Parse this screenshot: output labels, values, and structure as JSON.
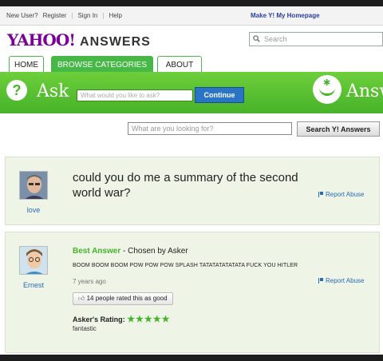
{
  "topbar": {
    "links": [
      "New User?",
      "Register",
      "Sign In",
      "Help"
    ],
    "homepage": "Make Y! My Homepage"
  },
  "logo": {
    "yahoo": "YAHOO!",
    "answers": "ANSWERS"
  },
  "header_search": {
    "placeholder": "Search"
  },
  "tabs": [
    {
      "label": "HOME",
      "active": false
    },
    {
      "label": "BROWSE CATEGORIES",
      "active": true
    },
    {
      "label": "ABOUT",
      "active": false
    }
  ],
  "ask_bar": {
    "ask_label": "Ask",
    "ask_placeholder": "What would you like to ask?",
    "continue_label": "Continue",
    "answer_label": "Answ"
  },
  "main_search": {
    "placeholder": "What are you looking for?",
    "button_label": "Search Y! Answers"
  },
  "question": {
    "user": "love",
    "text": "could you do me a summary of the second world war?",
    "report": "Report Abuse"
  },
  "best_answer": {
    "label": "Best Answer",
    "chosen_by": " - Chosen by Asker",
    "text": "BOOM BOOM BOOM POW POW POW SPLASH TATATATATATATA  FUCK YOU HITLER",
    "ago": "7 years ago",
    "user": "Ernest",
    "report": "Report Abuse",
    "rated": "14 people rated this as good",
    "rating_label": "Asker's Rating:",
    "stars": "★★★★★",
    "comment": "fantastic"
  },
  "colors": {
    "green": "#47b22a",
    "purple": "#7b0099",
    "link": "#2a6cb2",
    "button_blue": "#2a74c6"
  }
}
